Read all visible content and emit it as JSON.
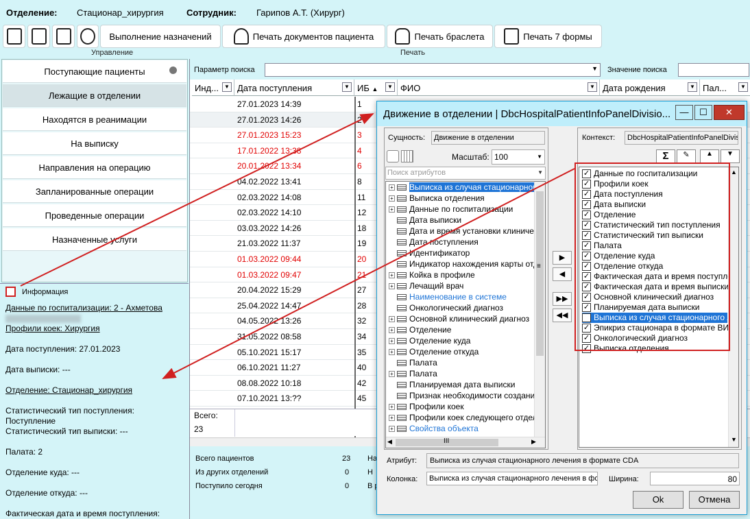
{
  "topbar": {
    "department_label": "Отделение:",
    "department_value": "Стационар_хирургия",
    "employee_label": "Сотрудник:",
    "employee_value": "Гарипов А.Т. (Хирург)"
  },
  "toolbar": {
    "execute_label": "Выполнение назначений",
    "print_docs_label": "Печать документов пациента",
    "print_bracelet_label": "Печать браслета",
    "print_form7_label": "Печать 7 формы",
    "group_manage": "Управление",
    "group_print": "Печать"
  },
  "nav": {
    "items": [
      "Поступающие пациенты",
      "Лежащие в отделении",
      "Находятся в реанимации",
      "На выписку",
      "Направления на операцию",
      "Запланированные операции",
      "Проведенные операции",
      "Назначенные услуги"
    ]
  },
  "info": {
    "title": "Информация",
    "hosp_data": "Данные по госпитализации: 2 - Ахметова",
    "bed_profile": "Профили коек: Хирургия",
    "admit_date": "Дата поступления: 27.01.2023",
    "discharge_date": "Дата выписки: ---",
    "department": "Отделение: Стационар_хирургия",
    "stat_admit_type": "Статистический тип поступления:",
    "stat_admit_value": "Поступление",
    "stat_discharge_type": "Статистический тип выписки: ---",
    "ward": "Палата: 2",
    "dept_to": "Отделение куда: ---",
    "dept_from": "Отделение откуда: ---",
    "actual_date": "Фактическая дата и время поступления:"
  },
  "search": {
    "param_label": "Параметр поиска",
    "value_label": "Значение поиска"
  },
  "grid": {
    "headers": [
      "Инд...",
      "Дата поступления",
      "ИБ",
      "ФИО",
      "Дата рождения",
      "Пал..."
    ],
    "rows": [
      {
        "date": "27.01.2023 14:39",
        "ib": "1",
        "red": false
      },
      {
        "date": "27.01.2023 14:26",
        "ib": "2",
        "red": false
      },
      {
        "date": "27.01.2023 15:23",
        "ib": "3",
        "red": true
      },
      {
        "date": "17.01.2022 13:38",
        "ib": "4",
        "red": true
      },
      {
        "date": "20.01.2022 13:34",
        "ib": "6",
        "red": true
      },
      {
        "date": "04.02.2022 13:41",
        "ib": "8",
        "red": false
      },
      {
        "date": "02.03.2022 14:08",
        "ib": "11",
        "red": false
      },
      {
        "date": "02.03.2022 14:10",
        "ib": "12",
        "red": false
      },
      {
        "date": "03.03.2022 14:26",
        "ib": "18",
        "red": false
      },
      {
        "date": "21.03.2022 11:37",
        "ib": "19",
        "red": false
      },
      {
        "date": "01.03.2022 09:44",
        "ib": "20",
        "red": true
      },
      {
        "date": "01.03.2022 09:47",
        "ib": "21",
        "red": true
      },
      {
        "date": "20.04.2022 15:29",
        "ib": "27",
        "red": false
      },
      {
        "date": "25.04.2022 14:47",
        "ib": "28",
        "red": false
      },
      {
        "date": "04.05.2022 13:26",
        "ib": "32",
        "red": false
      },
      {
        "date": "31.05.2022 08:58",
        "ib": "34",
        "red": false
      },
      {
        "date": "05.10.2021 15:17",
        "ib": "35",
        "red": false
      },
      {
        "date": "06.10.2021 11:27",
        "ib": "40",
        "red": false
      },
      {
        "date": "08.08.2022 10:18",
        "ib": "42",
        "red": false
      },
      {
        "date": "07.10.2021 13:??",
        "ib": "45",
        "red": false
      }
    ],
    "total_label": "Всего:",
    "total_value": "23"
  },
  "totals": {
    "all_patients_label": "Всего пациентов",
    "all_patients_value": "23",
    "from_other_label": "Из других отделений",
    "from_other_value": "0",
    "today_label": "Поступило сегодня",
    "today_value": "0",
    "col2_a": "На",
    "col2_b": "Н",
    "col2_c": "В р"
  },
  "dialog": {
    "title": "Движение в отделении | DbcHospitalPatientInfoPanelDivisio...",
    "entity_label": "Сущность:",
    "entity_value": "Движение в отделении",
    "context_label": "Контекст:",
    "context_value": "DbcHospitalPatientInfoPanelDivisi",
    "scale_label": "Масштаб:",
    "scale_value": "100",
    "search_placeholder": "Поиск атрибутов",
    "tree": [
      {
        "text": "Выписка из случая стационарного",
        "plus": true,
        "sel": true,
        "blue": false
      },
      {
        "text": "Выписка отделения",
        "plus": true,
        "sel": false,
        "blue": false
      },
      {
        "text": "Данные по госпитализации",
        "plus": true,
        "sel": false,
        "blue": false
      },
      {
        "text": "Дата выписки",
        "plus": false,
        "sel": false,
        "blue": false
      },
      {
        "text": "Дата и время установки клиничес",
        "plus": false,
        "sel": false,
        "blue": false
      },
      {
        "text": "Дата поступления",
        "plus": false,
        "sel": false,
        "blue": false
      },
      {
        "text": "Идентификатор",
        "plus": false,
        "sel": false,
        "blue": false
      },
      {
        "text": "Индикатор нахождения карты отде",
        "plus": false,
        "sel": false,
        "blue": false
      },
      {
        "text": "Койка в профиле",
        "plus": true,
        "sel": false,
        "blue": false
      },
      {
        "text": "Лечащий врач",
        "plus": true,
        "sel": false,
        "blue": false
      },
      {
        "text": "Наименование в системе",
        "plus": false,
        "sel": false,
        "blue": true
      },
      {
        "text": "Онкологический диагноз",
        "plus": false,
        "sel": false,
        "blue": false
      },
      {
        "text": "Основной клинический диагноз",
        "plus": true,
        "sel": false,
        "blue": false
      },
      {
        "text": "Отделение",
        "plus": true,
        "sel": false,
        "blue": false
      },
      {
        "text": "Отделение куда",
        "plus": true,
        "sel": false,
        "blue": false
      },
      {
        "text": "Отделение откуда",
        "plus": true,
        "sel": false,
        "blue": false
      },
      {
        "text": "Палата",
        "plus": false,
        "sel": false,
        "blue": false
      },
      {
        "text": "Палата",
        "plus": true,
        "sel": false,
        "blue": false
      },
      {
        "text": "Планируемая дата выписки",
        "plus": false,
        "sel": false,
        "blue": false
      },
      {
        "text": "Признак необходимости создания",
        "plus": false,
        "sel": false,
        "blue": false
      },
      {
        "text": "Профили коек",
        "plus": true,
        "sel": false,
        "blue": false
      },
      {
        "text": "Профили коек следующего отделе",
        "plus": true,
        "sel": false,
        "blue": false
      },
      {
        "text": "Свойства объекта",
        "plus": true,
        "sel": false,
        "blue": true
      }
    ],
    "columns": [
      "Данные по госпитализации",
      "Профили коек",
      "Дата поступления",
      "Дата выписки",
      "Отделение",
      "Статистический тип поступления",
      "Статистический тип выписки",
      "Палата",
      "Отделение куда",
      "Отделение откуда",
      "Фактическая дата и время поступлени",
      "Фактическая дата и время выписки",
      "Основной клинический диагноз",
      "Планируемая дата выписки",
      "Выписка из случая стационарного лече",
      "Эпикриз стационара в формате ВИМИ",
      "Онкологический диагноз",
      "Выписка отделения"
    ],
    "selected_column_index": 14,
    "attribute_label": "Атрибут:",
    "attribute_value": "Выписка из случая стационарного лечения в формате CDA",
    "column_label": "Колонка:",
    "column_value": "Выписка из случая стационарного лечения в фор",
    "width_label": "Ширина:",
    "width_value": "80",
    "ok_label": "Ok",
    "cancel_label": "Отмена"
  },
  "colors": {
    "bg": "#d4f4f8",
    "accent": "#1e74d6",
    "red": "#e10000",
    "highlight_box": "#d02020"
  }
}
